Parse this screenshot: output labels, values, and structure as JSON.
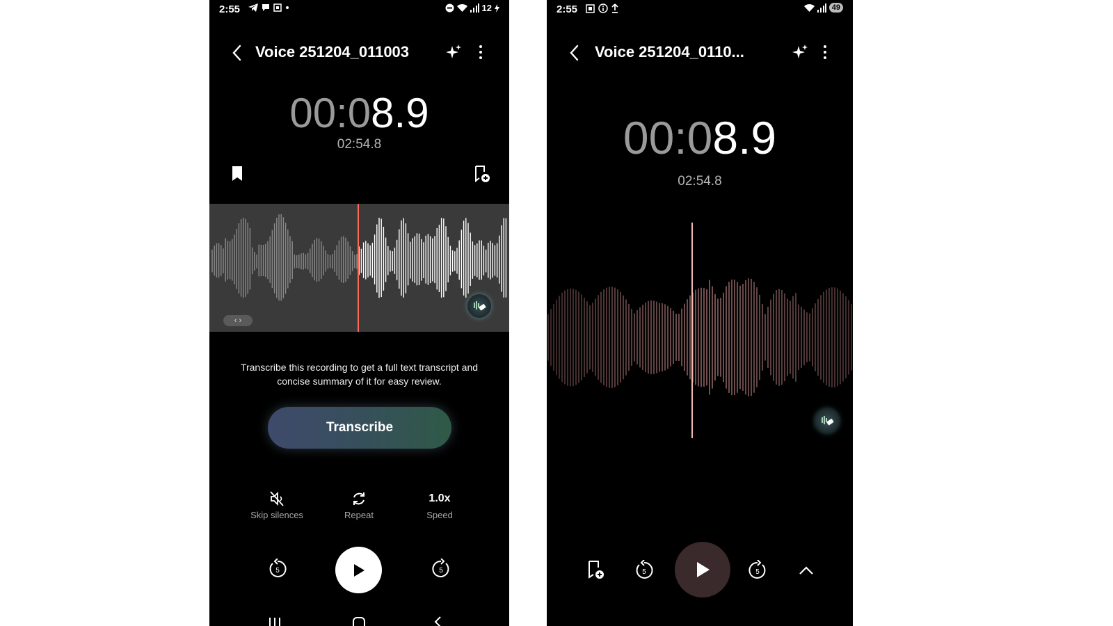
{
  "left_phone": {
    "status": {
      "time": "2:55",
      "battery": "12"
    },
    "header": {
      "title": "Voice 251204_011003"
    },
    "timer": {
      "dim": "00:0",
      "bright": "8.9"
    },
    "total": "02:54.8",
    "description": "Transcribe this recording to get a full text transcript and concise summary of it for easy review.",
    "transcribe_label": "Transcribe",
    "options": {
      "skip_silences": "Skip silences",
      "repeat": "Repeat",
      "speed_value": "1.0x",
      "speed": "Speed"
    },
    "skip_amount": "5",
    "icons": [
      "back-icon",
      "sparkle-icon",
      "more-icon",
      "bookmark-icon",
      "add-bookmark-icon",
      "skip-silences-icon",
      "repeat-icon",
      "rewind-5-icon",
      "play-icon",
      "forward-5-icon"
    ],
    "colors": {
      "playhead": "#ff6b5a",
      "panel": "#3a3a3a"
    }
  },
  "right_phone": {
    "status": {
      "time": "2:55",
      "battery": "49"
    },
    "header": {
      "title": "Voice 251204_0110..."
    },
    "timer": {
      "dim": "00:0",
      "bright": "8.9"
    },
    "total": "02:54.8",
    "skip_amount": "5",
    "icons": [
      "back-icon",
      "sparkle-icon",
      "more-icon",
      "add-bookmark-icon",
      "rewind-5-icon",
      "play-icon",
      "forward-5-icon",
      "chevron-up-icon"
    ],
    "colors": {
      "wave": "#e8a0a0",
      "play_bg": "#3a2a2b"
    }
  }
}
